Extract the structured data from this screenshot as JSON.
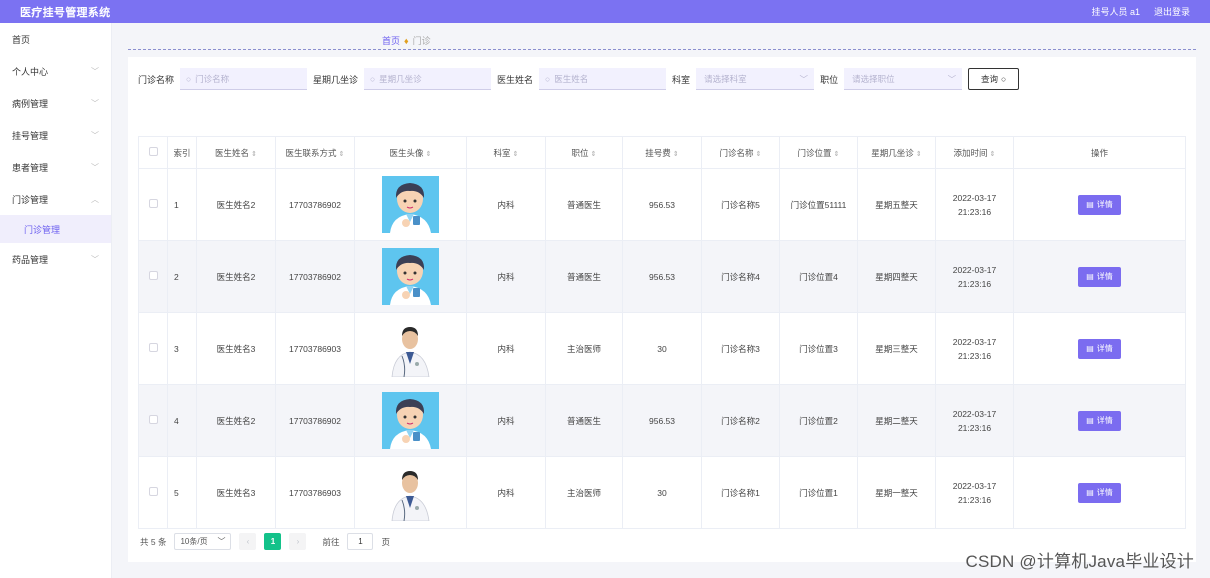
{
  "header": {
    "title": "医疗挂号管理系统",
    "user": "挂号人员 a1",
    "logout": "退出登录"
  },
  "sidebar": {
    "items": [
      {
        "label": "首页",
        "chevron": false
      },
      {
        "label": "个人中心",
        "chevron": true
      },
      {
        "label": "病例管理",
        "chevron": true
      },
      {
        "label": "挂号管理",
        "chevron": true
      },
      {
        "label": "患者管理",
        "chevron": true
      },
      {
        "label": "门诊管理",
        "chevron": true
      },
      {
        "label": "药品管理",
        "chevron": true
      }
    ],
    "active_sub": "门诊管理"
  },
  "breadcrumb": {
    "home": "首页",
    "current": "门诊"
  },
  "search": {
    "clinic_name_label": "门诊名称",
    "clinic_name_placeholder": "门诊名称",
    "weekday_label": "星期几坐诊",
    "weekday_placeholder": "星期几坐诊",
    "doctor_name_label": "医生姓名",
    "doctor_name_placeholder": "医生姓名",
    "dept_label": "科室",
    "dept_placeholder": "请选择科室",
    "title_label": "职位",
    "title_placeholder": "请选择职位",
    "query_button": "查询"
  },
  "table": {
    "headers": [
      "索引",
      "医生姓名",
      "医生联系方式",
      "医生头像",
      "科室",
      "职位",
      "挂号费",
      "门诊名称",
      "门诊位置",
      "星期几坐诊",
      "添加时间",
      "操作"
    ],
    "rows": [
      {
        "index": "1",
        "doctor": "医生姓名2",
        "phone": "17703786902",
        "avatar": "cartoon",
        "dept": "内科",
        "title": "普通医生",
        "fee": "956.53",
        "clinic": "门诊名称5",
        "location": "门诊位置51111",
        "weekday": "星期五整天",
        "time": "2022-03-17 21:23:16"
      },
      {
        "index": "2",
        "doctor": "医生姓名2",
        "phone": "17703786902",
        "avatar": "cartoon",
        "dept": "内科",
        "title": "普通医生",
        "fee": "956.53",
        "clinic": "门诊名称4",
        "location": "门诊位置4",
        "weekday": "星期四整天",
        "time": "2022-03-17 21:23:16"
      },
      {
        "index": "3",
        "doctor": "医生姓名3",
        "phone": "17703786903",
        "avatar": "photo",
        "dept": "内科",
        "title": "主治医师",
        "fee": "30",
        "clinic": "门诊名称3",
        "location": "门诊位置3",
        "weekday": "星期三整天",
        "time": "2022-03-17 21:23:16"
      },
      {
        "index": "4",
        "doctor": "医生姓名2",
        "phone": "17703786902",
        "avatar": "cartoon",
        "dept": "内科",
        "title": "普通医生",
        "fee": "956.53",
        "clinic": "门诊名称2",
        "location": "门诊位置2",
        "weekday": "星期二整天",
        "time": "2022-03-17 21:23:16"
      },
      {
        "index": "5",
        "doctor": "医生姓名3",
        "phone": "17703786903",
        "avatar": "photo",
        "dept": "内科",
        "title": "主治医师",
        "fee": "30",
        "clinic": "门诊名称1",
        "location": "门诊位置1",
        "weekday": "星期一整天",
        "time": "2022-03-17 21:23:16"
      }
    ],
    "detail_button": "详情"
  },
  "pagination": {
    "total": "共 5 条",
    "page_size": "10条/页",
    "current_page": "1",
    "goto_label": "前往",
    "goto_value": "1",
    "page_suffix": "页"
  },
  "watermark": "CSDN @计算机Java毕业设计",
  "colors": {
    "accent": "#7b72f2",
    "page_active": "#13c28a"
  }
}
